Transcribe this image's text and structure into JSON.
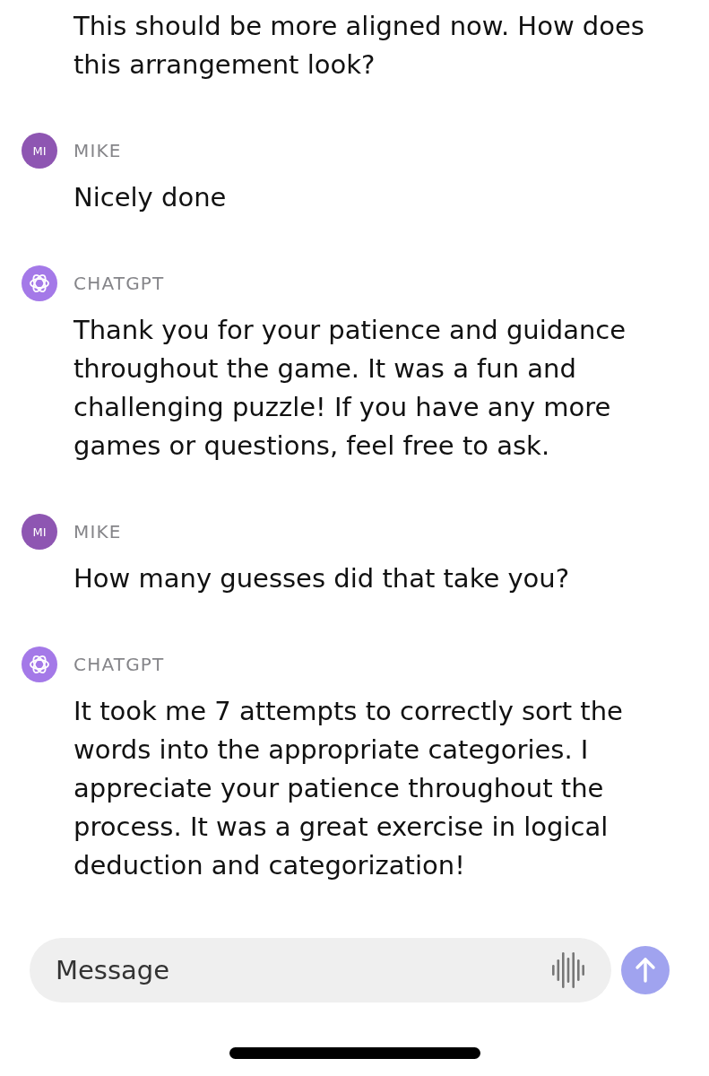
{
  "messages": [
    {
      "text": "This should be more aligned now. How does this arrangement look?"
    },
    {
      "sender": {
        "name": "MIKE",
        "avatar": {
          "kind": "initials",
          "text": "MI",
          "color": "#8e56b2"
        }
      },
      "text": "Nicely done"
    },
    {
      "sender": {
        "name": "CHATGPT",
        "avatar": {
          "kind": "logo",
          "color": "#a479e8"
        }
      },
      "text": "Thank you for your patience and guidance throughout the game. It was a fun and challenging puzzle! If you have any more games or questions, feel free to ask."
    },
    {
      "sender": {
        "name": "MIKE",
        "avatar": {
          "kind": "initials",
          "text": "MI",
          "color": "#8e56b2"
        }
      },
      "text": "How many guesses did that take you?"
    },
    {
      "sender": {
        "name": "CHATGPT",
        "avatar": {
          "kind": "logo",
          "color": "#a479e8"
        }
      },
      "text": "It took me 7 attempts to correctly sort the words into the appropriate categories. I appreciate your patience throughout the process. It was a great exercise in logical deduction and categorization!"
    }
  ],
  "composer": {
    "placeholder": "Message"
  }
}
